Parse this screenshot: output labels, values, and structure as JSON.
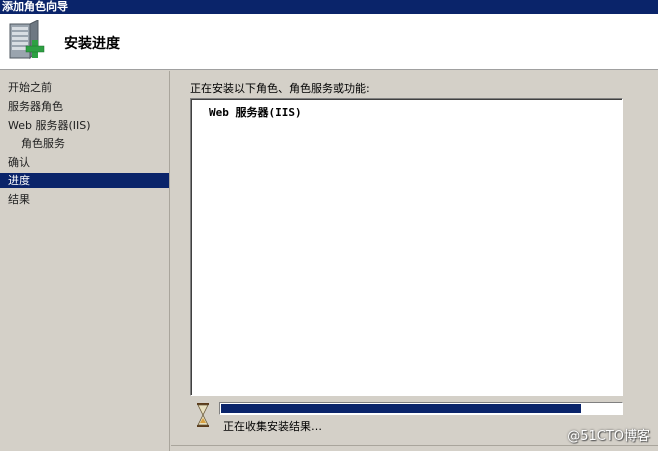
{
  "window": {
    "title": "添加角色向导"
  },
  "header": {
    "title": "安装进度",
    "icon": "server-add-icon"
  },
  "sidebar": {
    "items": [
      {
        "label": "开始之前",
        "active": false,
        "indent": false
      },
      {
        "label": "服务器角色",
        "active": false,
        "indent": false
      },
      {
        "label": "Web 服务器(IIS)",
        "active": false,
        "indent": false
      },
      {
        "label": "角色服务",
        "active": false,
        "indent": true
      },
      {
        "label": "确认",
        "active": false,
        "indent": false
      },
      {
        "label": "进度",
        "active": true,
        "indent": false
      },
      {
        "label": "结果",
        "active": false,
        "indent": false
      }
    ]
  },
  "main": {
    "label": "正在安装以下角色、角色服务或功能:",
    "installing_items": [
      "Web 服务器(IIS)"
    ],
    "progress_fraction": 0.9,
    "status": "正在收集安装结果…"
  },
  "watermark": "@51CTO博客",
  "colors": {
    "accent": "#0a246a",
    "background": "#d4d0c8",
    "progress_fill": "#0a246a"
  }
}
